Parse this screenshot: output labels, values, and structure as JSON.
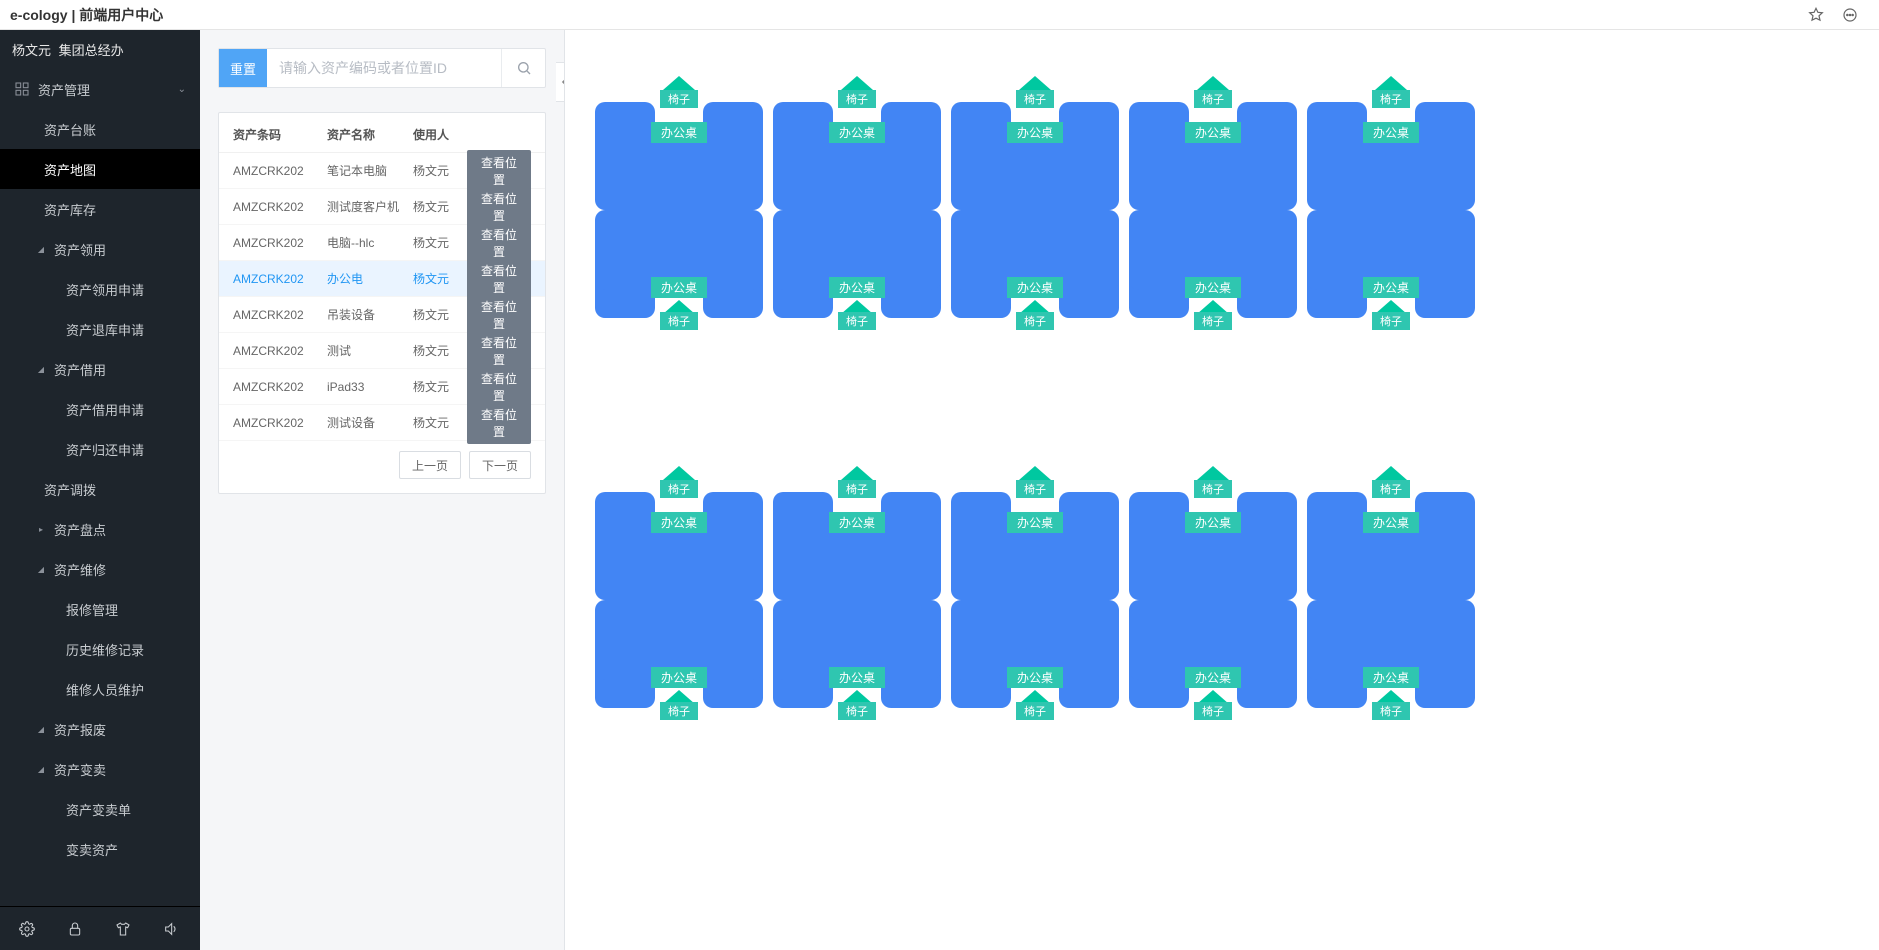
{
  "window": {
    "title": "e-cology | 前端用户中心"
  },
  "user": {
    "name": "杨文元",
    "dept": "集团总经办"
  },
  "nav": {
    "root_label": "资产管理",
    "items": [
      {
        "label": "资产台账",
        "level": 1
      },
      {
        "label": "资产地图",
        "level": 1,
        "active": true
      },
      {
        "label": "资产库存",
        "level": 1
      },
      {
        "label": "资产领用",
        "level": 1,
        "group": true,
        "expanded": true
      },
      {
        "label": "资产领用申请",
        "level": 2
      },
      {
        "label": "资产退库申请",
        "level": 2
      },
      {
        "label": "资产借用",
        "level": 1,
        "group": true,
        "expanded": true
      },
      {
        "label": "资产借用申请",
        "level": 2
      },
      {
        "label": "资产归还申请",
        "level": 2
      },
      {
        "label": "资产调拨",
        "level": 1
      },
      {
        "label": "资产盘点",
        "level": 1,
        "group": true,
        "expanded": false
      },
      {
        "label": "资产维修",
        "level": 1,
        "group": true,
        "expanded": true
      },
      {
        "label": "报修管理",
        "level": 2
      },
      {
        "label": "历史维修记录",
        "level": 2
      },
      {
        "label": "维修人员维护",
        "level": 2
      },
      {
        "label": "资产报废",
        "level": 1,
        "group": true,
        "expanded": true
      },
      {
        "label": "资产变卖",
        "level": 1,
        "group": true,
        "expanded": true
      },
      {
        "label": "资产变卖单",
        "level": 2
      },
      {
        "label": "变卖资产",
        "level": 2
      }
    ]
  },
  "search": {
    "reset_label": "重置",
    "placeholder": "请输入资产编码或者位置ID"
  },
  "table": {
    "headers": {
      "code": "资产条码",
      "name": "资产名称",
      "user": "使用人"
    },
    "view_label": "查看位置",
    "rows": [
      {
        "code": "AMZCRK202",
        "name": "笔记本电脑",
        "user": "杨文元"
      },
      {
        "code": "AMZCRK202",
        "name": "测试度客户机",
        "user": "杨文元"
      },
      {
        "code": "AMZCRK202",
        "name": "电脑--hlc",
        "user": "杨文元"
      },
      {
        "code": "AMZCRK202",
        "name": "办公电",
        "user": "杨文元",
        "selected": true
      },
      {
        "code": "AMZCRK202",
        "name": "吊装设备",
        "user": "杨文元"
      },
      {
        "code": "AMZCRK202",
        "name": "测试",
        "user": "杨文元"
      },
      {
        "code": "AMZCRK202",
        "name": "iPad33",
        "user": "杨文元"
      },
      {
        "code": "AMZCRK202",
        "name": "测试设备",
        "user": "杨文元"
      }
    ],
    "pager": {
      "prev": "上一页",
      "next": "下一页"
    }
  },
  "map": {
    "desk_label": "办公桌",
    "chair_label": "椅子",
    "row_count": 5,
    "blocks": 2
  }
}
